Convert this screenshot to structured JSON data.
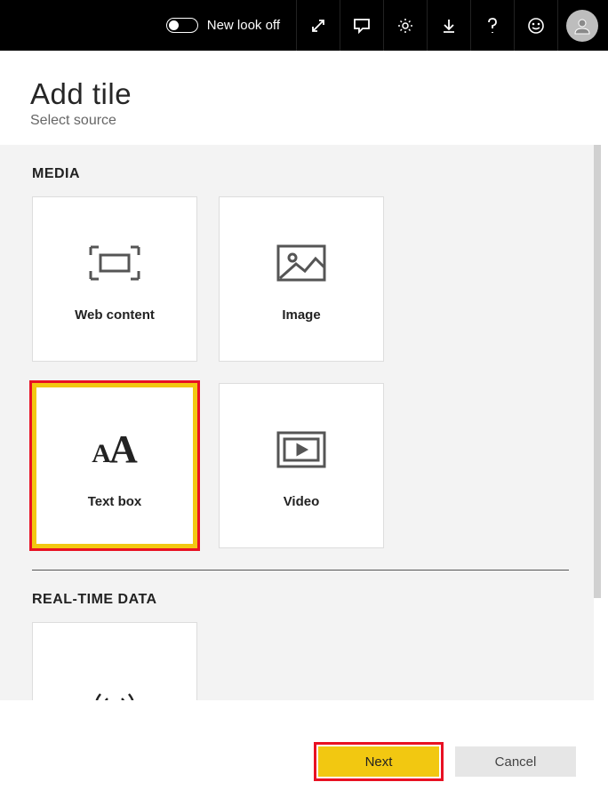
{
  "topbar": {
    "new_look_label": "New look off"
  },
  "header": {
    "title": "Add tile",
    "subtitle": "Select source"
  },
  "sections": {
    "media_label": "MEDIA",
    "realtime_label": "REAL-TIME DATA"
  },
  "tiles": {
    "web_content": "Web content",
    "image": "Image",
    "text_box": "Text box",
    "video": "Video"
  },
  "footer": {
    "next_label": "Next",
    "cancel_label": "Cancel"
  }
}
